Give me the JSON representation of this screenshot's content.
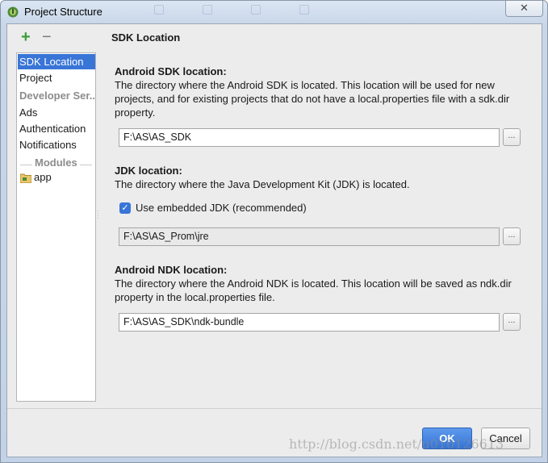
{
  "window": {
    "title": "Project Structure",
    "close_glyph": "✕"
  },
  "toolbar": {
    "add_label": "+",
    "remove_label": "−"
  },
  "sidebar": {
    "items": [
      {
        "label": "SDK Location",
        "selected": true
      },
      {
        "label": "Project",
        "selected": false
      },
      {
        "label": "Developer Ser...",
        "category": true
      },
      {
        "label": "Ads",
        "selected": false
      },
      {
        "label": "Authentication",
        "selected": false
      },
      {
        "label": "Notifications",
        "selected": false
      }
    ],
    "modules_label": "Modules",
    "modules": [
      {
        "label": "app",
        "icon": "module-folder-icon"
      }
    ]
  },
  "main": {
    "heading": "SDK Location",
    "android_sdk": {
      "label": "Android SDK location:",
      "description": "The directory where the Android SDK is located. This location will be used for new projects, and for existing projects that do not have a local.properties file with a sdk.dir property.",
      "value": "F:\\AS\\AS_SDK",
      "browse_label": "..."
    },
    "jdk": {
      "label": "JDK location:",
      "description": "The directory where the Java Development Kit (JDK) is located.",
      "embedded_checkbox_label": "Use embedded JDK (recommended)",
      "embedded_checked": true,
      "value": "F:\\AS\\AS_Prom\\jre",
      "browse_label": "..."
    },
    "android_ndk": {
      "label": "Android NDK location:",
      "description": "The directory where the Android NDK is located. This location will be saved as ndk.dir property in the local.properties file.",
      "value": "F:\\AS\\AS_SDK\\ndk-bundle",
      "browse_label": "..."
    }
  },
  "footer": {
    "ok_label": "OK",
    "cancel_label": "Cancel"
  },
  "watermark": "http://blog.csdn.net/u010126613",
  "colors": {
    "accent": "#3875d7",
    "add_green": "#3a9e3a"
  }
}
